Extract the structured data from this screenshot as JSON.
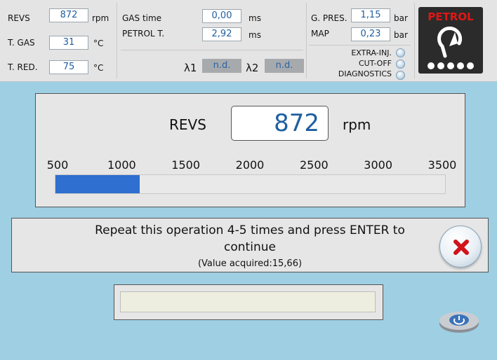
{
  "top": {
    "revs": {
      "label": "REVS",
      "value": "872",
      "unit": "rpm"
    },
    "t_gas": {
      "label": "T. GAS",
      "value": "31",
      "unit": "°C"
    },
    "t_red": {
      "label": "T. RED.",
      "value": "75",
      "unit": "°C"
    },
    "gas_time": {
      "label": "GAS time",
      "value": "0,00",
      "unit": "ms"
    },
    "petrol_t": {
      "label": "PETROL T.",
      "value": "2,92",
      "unit": "ms"
    },
    "lambda1": {
      "label": "λ1",
      "value": "n.d."
    },
    "lambda2": {
      "label": "λ2",
      "value": "n.d."
    },
    "g_pres": {
      "label": "G. PRES.",
      "value": "1,15",
      "unit": "bar"
    },
    "map": {
      "label": "MAP",
      "value": "0,23",
      "unit": "bar"
    },
    "indicators": [
      "EXTRA-INJ.",
      "CUT-OFF",
      "DIAGNOSTICS"
    ],
    "fuel_mode": "PETROL"
  },
  "revs_panel": {
    "label": "REVS",
    "value": "872",
    "unit": "rpm",
    "scale": [
      "500",
      "1000",
      "1500",
      "2000",
      "2500",
      "3000",
      "3500"
    ],
    "scale_min": 500,
    "scale_max": 3500,
    "fill_value": 872
  },
  "message": {
    "line1": "Repeat this operation 4-5 times and press ENTER to",
    "line2": "continue",
    "line3": "(Value acquired:15,66)"
  },
  "colors": {
    "accent": "#2e6fcf",
    "value_text": "#1f5fa0",
    "background": "#9ecfe3",
    "petrol_red": "#e21616"
  }
}
